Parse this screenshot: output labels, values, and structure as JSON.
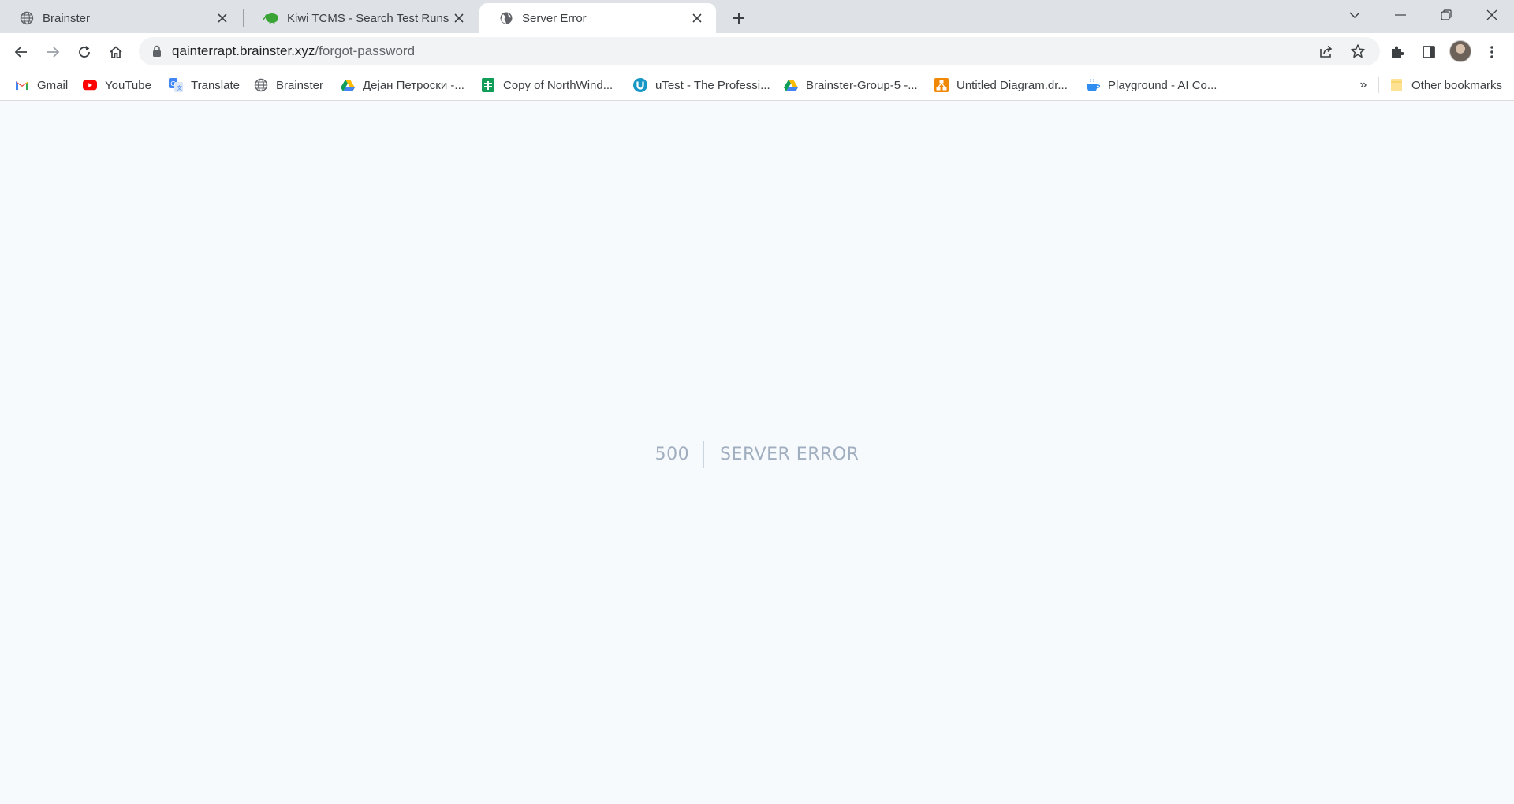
{
  "tabs": [
    {
      "title": "Brainster",
      "icon": "globe-icon",
      "active": false
    },
    {
      "title": "Kiwi TCMS - Search Test Runs",
      "icon": "kiwi-icon",
      "active": false
    },
    {
      "title": "Server Error",
      "icon": "globe-icon",
      "active": true
    }
  ],
  "address_bar": {
    "host": "qainterrapt.brainster.xyz",
    "path": "/forgot-password"
  },
  "bookmarks": [
    {
      "label": "Gmail",
      "icon": "gmail-icon"
    },
    {
      "label": "YouTube",
      "icon": "youtube-icon"
    },
    {
      "label": "Translate",
      "icon": "translate-icon"
    },
    {
      "label": "Brainster",
      "icon": "globe-icon"
    },
    {
      "label": "Дејан Петроски -...",
      "icon": "google-drive-icon"
    },
    {
      "label": "Copy of NorthWind...",
      "icon": "google-sheets-icon"
    },
    {
      "label": "uTest - The Professi...",
      "icon": "utest-icon"
    },
    {
      "label": "Brainster-Group-5 -...",
      "icon": "google-drive-icon"
    },
    {
      "label": "Untitled Diagram.dr...",
      "icon": "drawio-icon"
    },
    {
      "label": "Playground - AI Co...",
      "icon": "playground-icon"
    }
  ],
  "other_bookmarks_label": "Other bookmarks",
  "overflow_label": "»",
  "error": {
    "code": "500",
    "message": "Server Error"
  },
  "colors": {
    "page_background": "#f7fafc",
    "error_text": "#a0aec0",
    "tabstrip": "#dee1e6"
  }
}
